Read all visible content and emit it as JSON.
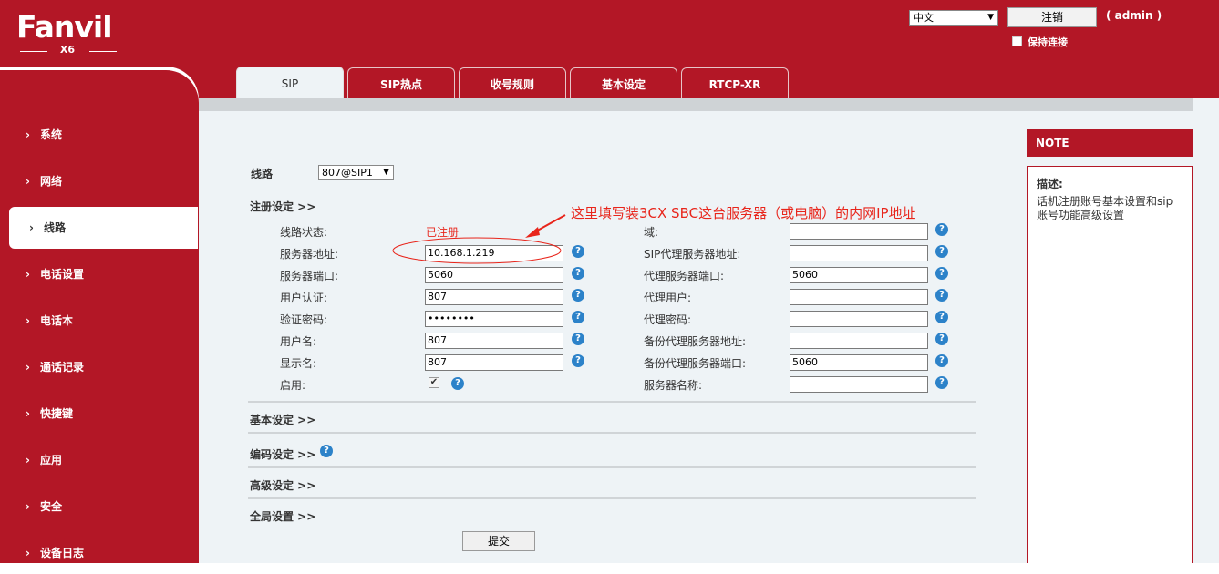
{
  "header": {
    "logo_text": "Fanvil",
    "model": "X6",
    "language": "中文",
    "logout_label": "注销",
    "user_label": "( admin )",
    "keep_connected_label": "保持连接"
  },
  "sidebar": {
    "items": [
      {
        "label": "系统"
      },
      {
        "label": "网络"
      },
      {
        "label": "线路"
      },
      {
        "label": "电话设置"
      },
      {
        "label": "电话本"
      },
      {
        "label": "通话记录"
      },
      {
        "label": "快捷键"
      },
      {
        "label": "应用"
      },
      {
        "label": "安全"
      },
      {
        "label": "设备日志"
      }
    ],
    "active": "线路",
    "chevron": "›"
  },
  "tabs": [
    {
      "label": "SIP"
    },
    {
      "label": "SIP热点"
    },
    {
      "label": "收号规则"
    },
    {
      "label": "基本设定"
    },
    {
      "label": "RTCP-XR"
    }
  ],
  "line": {
    "label": "线路",
    "value": "807@SIP1"
  },
  "registration": {
    "section_label": "注册设定 >>",
    "left": [
      {
        "label": "线路状态:",
        "value": "已注册"
      },
      {
        "label": "服务器地址:",
        "value": "10.168.1.219"
      },
      {
        "label": "服务器端口:",
        "value": "5060"
      },
      {
        "label": "用户认证:",
        "value": "807"
      },
      {
        "label": "验证密码:",
        "value": "••••••••"
      },
      {
        "label": "用户名:",
        "value": "807"
      },
      {
        "label": "显示名:",
        "value": "807"
      },
      {
        "label": "启用:",
        "value": "✔"
      }
    ],
    "right": [
      {
        "label": "域:",
        "value": ""
      },
      {
        "label": "SIP代理服务器地址:",
        "value": ""
      },
      {
        "label": "代理服务器端口:",
        "value": "5060"
      },
      {
        "label": "代理用户:",
        "value": ""
      },
      {
        "label": "代理密码:",
        "value": ""
      },
      {
        "label": "备份代理服务器地址:",
        "value": ""
      },
      {
        "label": "备份代理服务器端口:",
        "value": "5060"
      },
      {
        "label": "服务器名称:",
        "value": ""
      }
    ]
  },
  "sections": {
    "basic": "基本设定 >>",
    "codec": "编码设定 >>",
    "advanced": "高级设定 >>",
    "global": "全局设置 >>"
  },
  "submit_label": "提交",
  "help_glyph": "?",
  "note": {
    "title": "NOTE",
    "desc_label": "描述:",
    "desc_text": "话机注册账号基本设置和sip账号功能高级设置"
  },
  "annotation": {
    "text": "这里填写装3CX SBC这台服务器（或电脑）的内网IP地址",
    "color": "#e8251b"
  },
  "colors": {
    "brand": "#b31726",
    "content_bg": "#eef3f6",
    "help_blue": "#2c82c9"
  }
}
